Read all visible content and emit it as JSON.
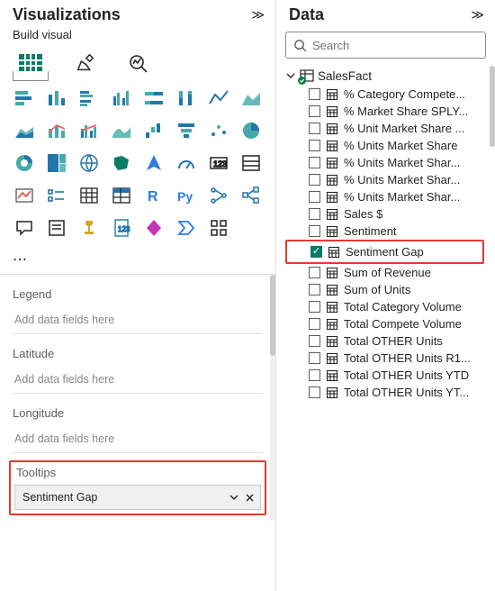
{
  "viz": {
    "title": "Visualizations",
    "subtitle": "Build visual",
    "dropPlaceholder": "Add data fields here",
    "wells": {
      "legend": "Legend",
      "latitude": "Latitude",
      "longitude": "Longitude",
      "tooltips": "Tooltips"
    },
    "tooltipsChip": "Sentiment Gap"
  },
  "data": {
    "title": "Data",
    "searchPlaceholder": "Search",
    "table": "SalesFact",
    "fields": [
      {
        "label": "% Category Compete...",
        "checked": false
      },
      {
        "label": "% Market Share SPLY...",
        "checked": false
      },
      {
        "label": "% Unit Market Share ...",
        "checked": false
      },
      {
        "label": "% Units Market Share",
        "checked": false
      },
      {
        "label": "% Units Market Shar...",
        "checked": false
      },
      {
        "label": "% Units Market Shar...",
        "checked": false
      },
      {
        "label": "% Units Market Shar...",
        "checked": false
      },
      {
        "label": "Sales $",
        "checked": false
      },
      {
        "label": "Sentiment",
        "checked": false
      },
      {
        "label": "Sentiment Gap",
        "checked": true,
        "hl": true
      },
      {
        "label": "Sum of Revenue",
        "checked": false
      },
      {
        "label": "Sum of Units",
        "checked": false
      },
      {
        "label": "Total Category Volume",
        "checked": false
      },
      {
        "label": "Total Compete Volume",
        "checked": false
      },
      {
        "label": "Total OTHER Units",
        "checked": false
      },
      {
        "label": "Total OTHER Units R1...",
        "checked": false
      },
      {
        "label": "Total OTHER Units YTD",
        "checked": false
      },
      {
        "label": "Total OTHER Units YT...",
        "checked": false
      }
    ]
  }
}
